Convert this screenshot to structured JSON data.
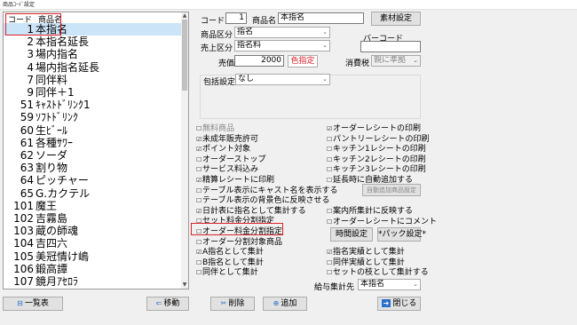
{
  "window": {
    "title": "商品ｺｰﾄﾞ設定"
  },
  "list": {
    "header": {
      "code": "コード",
      "name": "商品名"
    },
    "rows": [
      {
        "code": "1",
        "name": "本指名"
      },
      {
        "code": "2",
        "name": "本指名延長"
      },
      {
        "code": "3",
        "name": "場内指名"
      },
      {
        "code": "4",
        "name": "場内指名延長"
      },
      {
        "code": "7",
        "name": "同伴料"
      },
      {
        "code": "9",
        "name": "同伴＋1"
      },
      {
        "code": "51",
        "name": "ｷｬｽﾄﾄﾞﾘﾝｸ1"
      },
      {
        "code": "59",
        "name": "ｿﾌﾄﾄﾞﾘﾝｸ"
      },
      {
        "code": "60",
        "name": "生ﾋﾞｰﾙ"
      },
      {
        "code": "61",
        "name": "各種ｻﾜｰ"
      },
      {
        "code": "62",
        "name": "ソーダ"
      },
      {
        "code": "63",
        "name": "割り物"
      },
      {
        "code": "64",
        "name": "ピッチャー"
      },
      {
        "code": "65",
        "name": "G.カクテル"
      },
      {
        "code": "101",
        "name": "魔王"
      },
      {
        "code": "102",
        "name": "吉霧島"
      },
      {
        "code": "103",
        "name": "蔵の師魂"
      },
      {
        "code": "104",
        "name": "吉四六"
      },
      {
        "code": "105",
        "name": "美冠情け嶋"
      },
      {
        "code": "106",
        "name": "鍛高譚"
      },
      {
        "code": "107",
        "name": "鏡月ｱｾﾛﾗ"
      }
    ]
  },
  "form": {
    "code_label": "コード",
    "code_value": "1",
    "name_label": "商品名",
    "name_value": "本指名",
    "material_button": "素材設定",
    "category_label": "商品区分",
    "category_value": "指名",
    "sales_label": "売上区分",
    "sales_value": "指名料",
    "barcode_label": "バーコード",
    "barcode_value": "",
    "price_label": "売価",
    "price_value": "2000",
    "color_button": "色指定",
    "tax_label": "消費税",
    "tax_value": "親に準拠",
    "package_label": "包括設定",
    "package_value": "なし"
  },
  "checks_left": [
    {
      "label": "無料商品",
      "checked": false,
      "dim": true
    },
    {
      "label": "未成年販売許可",
      "checked": true
    },
    {
      "label": "ポイント対象",
      "checked": true
    },
    {
      "label": "オーダーストップ",
      "checked": false
    },
    {
      "label": "サービス料込み",
      "checked": false
    },
    {
      "label": "精算レシートに印刷",
      "checked": true
    },
    {
      "label": "テーブル表示にキャスト名を表示する",
      "checked": false
    },
    {
      "label": "テーブル表示の背景色に反映させる",
      "checked": false
    },
    {
      "label": "日計表に指名として集計する",
      "checked": true
    },
    {
      "label": "セット料金分割指定",
      "checked": false
    },
    {
      "label": "オーダー料金分割指定",
      "checked": false
    },
    {
      "label": "オーダー分割対象商品",
      "checked": false
    },
    {
      "label": "A指名として集計",
      "checked": true
    },
    {
      "label": "B指名として集計",
      "checked": false
    },
    {
      "label": "同伴として集計",
      "checked": false
    }
  ],
  "checks_right": [
    {
      "label": "オーダーレシートの印刷",
      "checked": true
    },
    {
      "label": "パントリーレシートの印刷",
      "checked": false
    },
    {
      "label": "キッチン1レシートの印刷",
      "checked": false
    },
    {
      "label": "キッチン2レシートの印刷",
      "checked": false
    },
    {
      "label": "キッチン3レシートの印刷",
      "checked": false
    },
    {
      "label": "延長時に自動追加する",
      "checked": false
    }
  ],
  "checks_right2": [
    {
      "label": "案内所集計に反映する",
      "checked": false
    },
    {
      "label": "オーダーレシートにコメント",
      "checked": false
    }
  ],
  "checks_right3": [
    {
      "label": "指名実績として集計",
      "checked": true
    },
    {
      "label": "同伴実績として集計",
      "checked": false
    },
    {
      "label": "セットの枝として集計する",
      "checked": false
    }
  ],
  "auto_add_button": "自動追加商品設定",
  "time_button": "時間設定",
  "pack_button": "*パック設定*",
  "salary_label": "給与集計先",
  "salary_value": "本指名",
  "bottom": {
    "list_button": "一覧表",
    "move_button": "移動",
    "delete_button": "削除",
    "add_button": "追加",
    "close_button": "閉じる"
  }
}
